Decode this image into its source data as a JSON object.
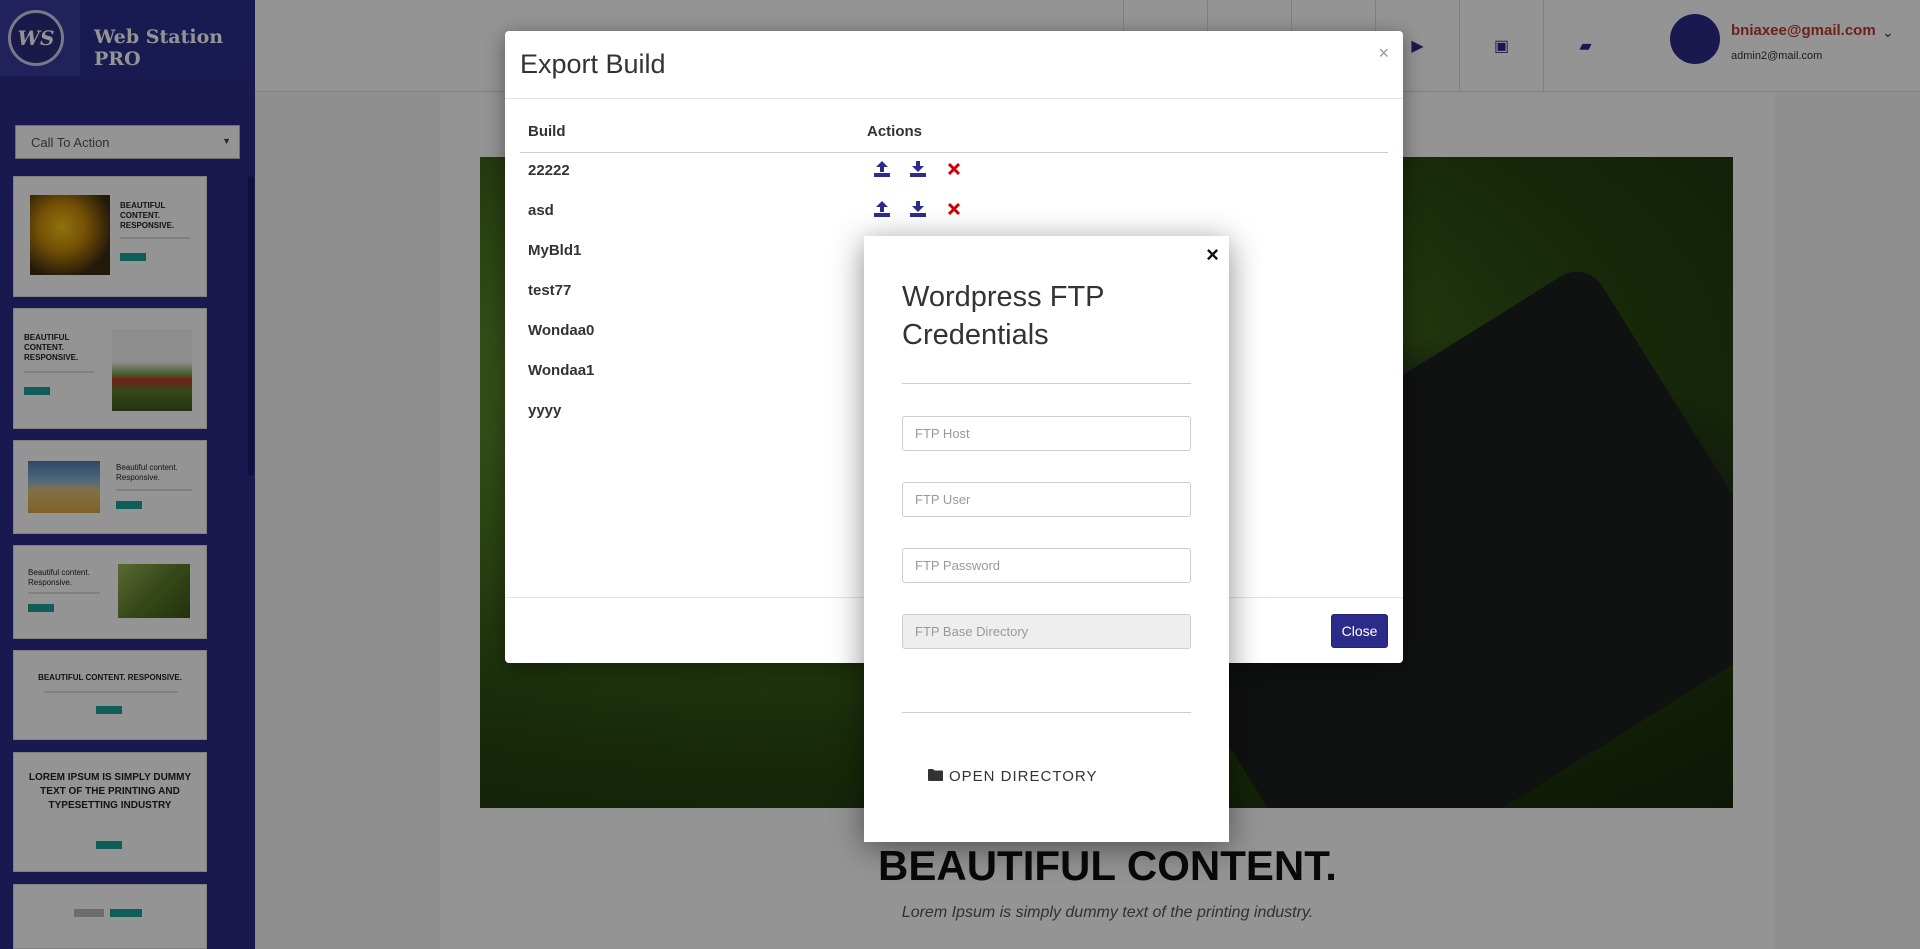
{
  "app": {
    "brand_initials": "WS",
    "brand_name": "Web Station PRO",
    "accent_color": "#2b2b8a"
  },
  "sidebar": {
    "category_select": "Call To Action",
    "thumbnails": [
      {
        "heading": "BEAUTIFUL CONTENT. RESPONSIVE."
      },
      {
        "heading": "BEAUTIFUL CONTENT. RESPONSIVE."
      },
      {
        "heading": "Beautiful content. Responsive."
      },
      {
        "heading": "Beautiful content. Responsive."
      },
      {
        "heading": "BEAUTIFUL CONTENT. RESPONSIVE."
      },
      {
        "heading": "LOREM IPSUM IS SIMPLY DUMMY TEXT OF THE PRINTING AND TYPESETTING INDUSTRY"
      },
      {
        "heading": ""
      }
    ]
  },
  "user": {
    "email": "bniaxee@gmail.com",
    "secondary": "admin2@mail.com"
  },
  "canvas": {
    "heading": "BEAUTIFUL CONTENT.",
    "subheading": "Lorem Ipsum is simply dummy text of the printing industry."
  },
  "export_modal": {
    "title": "Export Build",
    "close_x": "×",
    "col_build": "Build",
    "col_actions": "Actions",
    "builds": [
      "22222",
      "asd",
      "MyBld1",
      "test77",
      "Wondaa0",
      "Wondaa1",
      "yyyy"
    ],
    "close_label": "Close"
  },
  "ftp_modal": {
    "close_x": "×",
    "title": "Wordpress FTP Credentials",
    "host_placeholder": "FTP Host",
    "user_placeholder": "FTP User",
    "password_placeholder": "FTP Password",
    "base_dir_placeholder": "FTP Base Directory",
    "open_directory_label": "OPEN DIRECTORY"
  },
  "icons": {
    "upload": "upload-icon",
    "download": "download-icon",
    "delete": "delete-icon",
    "folder": "folder-icon"
  },
  "colors": {
    "delete": "#cc0000",
    "action_blue": "#2b2b8a",
    "email": "#c0392b"
  }
}
